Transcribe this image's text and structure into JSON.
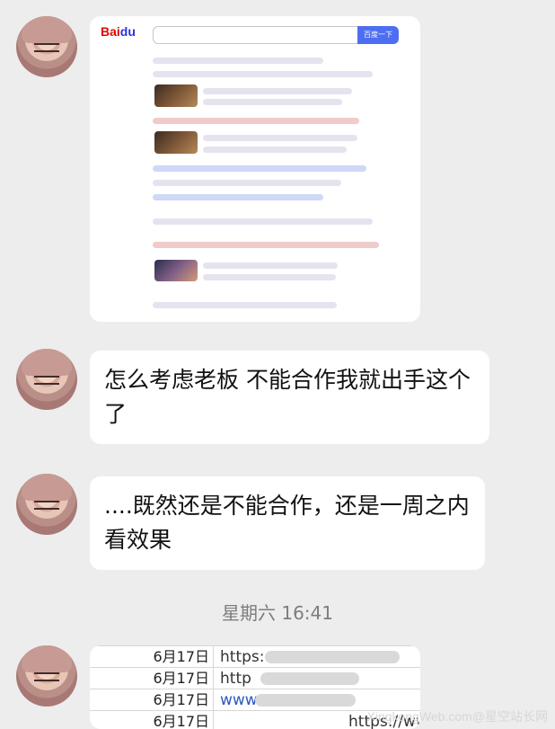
{
  "messages": [
    {
      "type": "image",
      "search_button": "百度一下"
    },
    {
      "type": "text",
      "text": "怎么考虑老板 不能合作我就出手这个了"
    },
    {
      "type": "text",
      "text": "....既然还是不能合作，还是一周之内看效果"
    },
    {
      "type": "image",
      "rows": [
        {
          "date": "6月17日",
          "url": "https:"
        },
        {
          "date": "6月17日",
          "url": "http"
        },
        {
          "date": "6月17日",
          "url": "www."
        },
        {
          "date": "6月17日",
          "url": "https://ww"
        }
      ]
    }
  ],
  "timestamp": "星期六 16:41",
  "watermark": "XingkongWeb.com@星空站长网"
}
